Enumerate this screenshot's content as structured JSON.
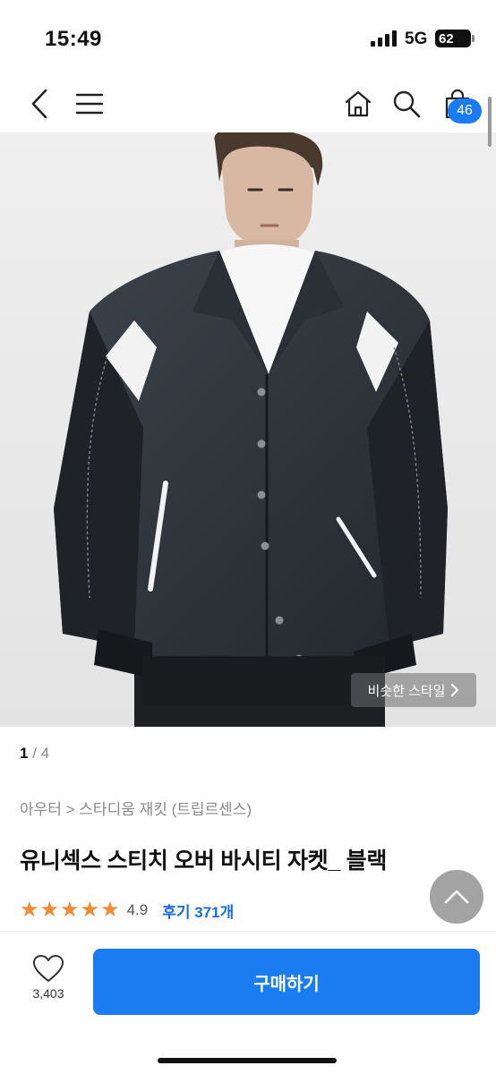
{
  "status_bar": {
    "time": "15:49",
    "network": "5G",
    "battery": "62"
  },
  "nav": {
    "cart_count": "46"
  },
  "hero": {
    "similar_style_label": "비슷한 스타일",
    "pager_current": "1",
    "pager_total": "4"
  },
  "product": {
    "breadcrumb": "아우터 > 스타디움 재킷 (트립르센스)",
    "title": "유니섹스 스티치 오버 바시티 자켓_ 블랙",
    "rating": "4.9",
    "rating_stars": 5,
    "reviews_label": "후기 371개"
  },
  "bottom": {
    "like_count": "3,403",
    "buy_label": "구매하기"
  },
  "colors": {
    "accent": "#1a7cf0",
    "star": "#f08a36",
    "review_link": "#1a6ed8"
  },
  "icons": [
    "back-icon",
    "menu-icon",
    "home-icon",
    "search-icon",
    "shopping-bag-icon",
    "chevron-right-icon",
    "chevron-up-icon",
    "heart-icon"
  ]
}
